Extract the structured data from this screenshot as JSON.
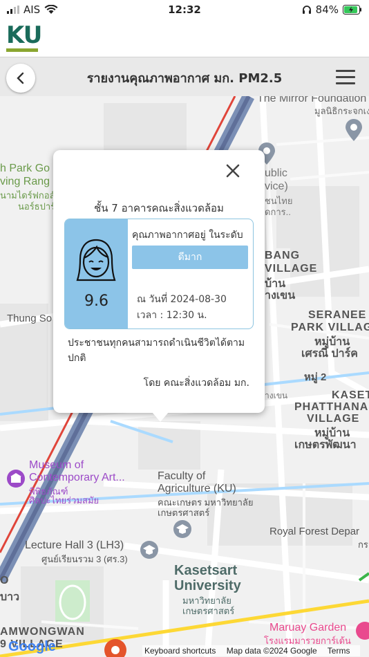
{
  "status_bar": {
    "carrier": "AIS",
    "time": "12:32",
    "battery": "84%"
  },
  "app": {
    "logo_text": "KU"
  },
  "nav": {
    "title": "รายงานคุณภาพอากาศ มก. PM2.5"
  },
  "popup": {
    "location": "ชั้น 7 อาคารคณะสิ่งแวดล้อม",
    "pm25_value": "9.6",
    "quality_label": "คุณภาพอากาศอยู่ ในระดับ",
    "quality_level": "ดีมาก",
    "date_line": "ณ วันที่ 2024-08-30",
    "time_line": "เวลา : 12:30 น.",
    "advice": "ประชาชนทุกคนสามารถดำเนินชีวิตได้ตามปกติ",
    "credit": "โดย คณะสิ่งแวดล้อม มก.",
    "accent_color": "#8cc4e8"
  },
  "map": {
    "labels": {
      "mirror_foundation": "The Mirror Foundation",
      "mirror_foundation_th": "มูลนิธิกระจกเงา",
      "park_golf": "h Park Go",
      "driving_range": "ving Rang",
      "park_th1": "นามไดร์ฟกอล์",
      "park_th2": "นอร์ธปาร์",
      "public": "ublic",
      "service": "vice)",
      "public_th1": "ชนไทย",
      "public_th2": "ดการ..",
      "bang_village": "BANG",
      "village2": "VILLAGE",
      "village_th1": "บ้าน",
      "village_th2": "างเขน",
      "thung_song": "Thung So",
      "seranee": "SERANEE",
      "park_village": "PARK VILLAG",
      "seranee_th1": "หมู่บ้าน",
      "seranee_th2": "เศรณี ปาร์ค",
      "moo2": "หมู่ 2",
      "kaset": "KASET",
      "phatthana": "PHATTHANA",
      "kaset_village": "VILLAGE",
      "kaset_th1": "หมู่บ้าน",
      "kaset_th2": "เกษตรพัฒนา",
      "bangkhen_road": "างเขน",
      "museum1": "Museum of",
      "museum2": "Contemporary Art...",
      "museum_th1": "พิพิธภัณฑ์",
      "museum_th2": "ศิลปะไทยร่วมสมัย",
      "faculty1": "Faculty of",
      "faculty2": "Agriculture (KU)",
      "faculty_th1": "คณะเกษตร มหาวิทยาลัย",
      "faculty_th2": "เกษตรศาสตร์",
      "royal_forest": "Royal Forest Depar",
      "royal_forest_th": "กร",
      "lecture1": "Lecture Hall 3 (LH3)",
      "lecture_th": "ศูนย์เรียนรวม 3 (ศร.3)",
      "ku1": "Kasetsart",
      "ku2": "University",
      "ku_th1": "มหาวิทยาลัย",
      "ku_th2": "เกษตรศาสตร์",
      "maruay1": "Maruay Garden",
      "maruay2": "โรงแรมมารวยการ์เด้น",
      "samwongwan": "AMWONGWAN",
      "samwongwan2": "9 VILLAGE",
      "left_o": "O",
      "left_th": "บาว"
    },
    "attribution": {
      "shortcuts": "Keyboard shortcuts",
      "map_data": "Map data ©2024 Google",
      "terms": "Terms"
    },
    "google_logo": "Google"
  }
}
